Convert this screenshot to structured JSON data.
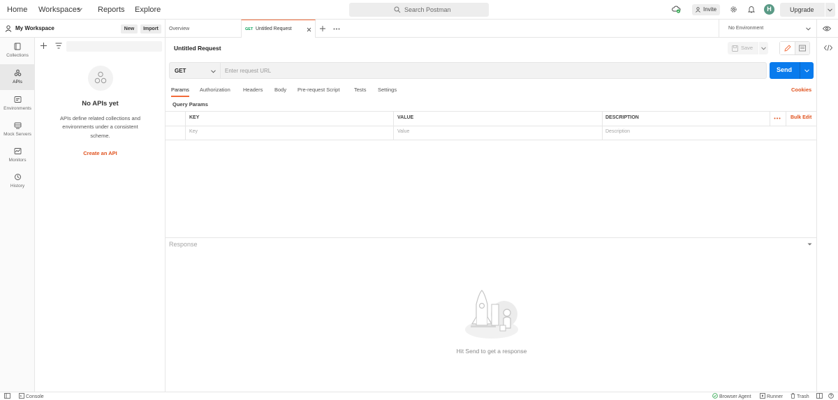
{
  "topbar": {
    "nav": [
      "Home",
      "Workspaces",
      "Reports",
      "Explore"
    ],
    "search_placeholder": "Search Postman",
    "invite": "Invite",
    "avatar_initial": "H",
    "upgrade": "Upgrade"
  },
  "workspace": {
    "name": "My Workspace",
    "new": "New",
    "import": "Import"
  },
  "rail": {
    "items": [
      {
        "label": "Collections",
        "icon": "collections-icon"
      },
      {
        "label": "APIs",
        "icon": "apis-icon",
        "active": true
      },
      {
        "label": "Environments",
        "icon": "environments-icon"
      },
      {
        "label": "Mock Servers",
        "icon": "mock-servers-icon"
      },
      {
        "label": "Monitors",
        "icon": "monitors-icon"
      },
      {
        "label": "History",
        "icon": "history-icon"
      }
    ]
  },
  "sidepanel": {
    "empty_title": "No APIs yet",
    "empty_desc_1": "APIs define related collections and",
    "empty_desc_2": "environments under a consistent",
    "empty_desc_3": "scheme.",
    "create_link": "Create an API"
  },
  "tabs": {
    "overview": "Overview",
    "active_method": "GET",
    "active_name": "Untitled Request",
    "environment": "No Environment"
  },
  "request": {
    "title": "Untitled Request",
    "save": "Save",
    "method": "GET",
    "url_placeholder": "Enter request URL",
    "send": "Send",
    "tabs": [
      "Params",
      "Authorization",
      "Headers",
      "Body",
      "Pre-request Script",
      "Tests",
      "Settings"
    ],
    "cookies": "Cookies",
    "query_params_title": "Query Params",
    "columns": [
      "KEY",
      "VALUE",
      "DESCRIPTION"
    ],
    "bulk_edit": "Bulk Edit",
    "row_placeholders": [
      "Key",
      "Value",
      "Description"
    ]
  },
  "response": {
    "label": "Response",
    "empty_message": "Hit Send to get a response"
  },
  "footer": {
    "console": "Console",
    "browser_agent": "Browser Agent",
    "runner": "Runner",
    "trash": "Trash"
  },
  "colors": {
    "accent_orange": "#f26b3a",
    "send_blue": "#097bed",
    "link_orange": "#e0531f",
    "sync_green": "#2aa54a"
  }
}
